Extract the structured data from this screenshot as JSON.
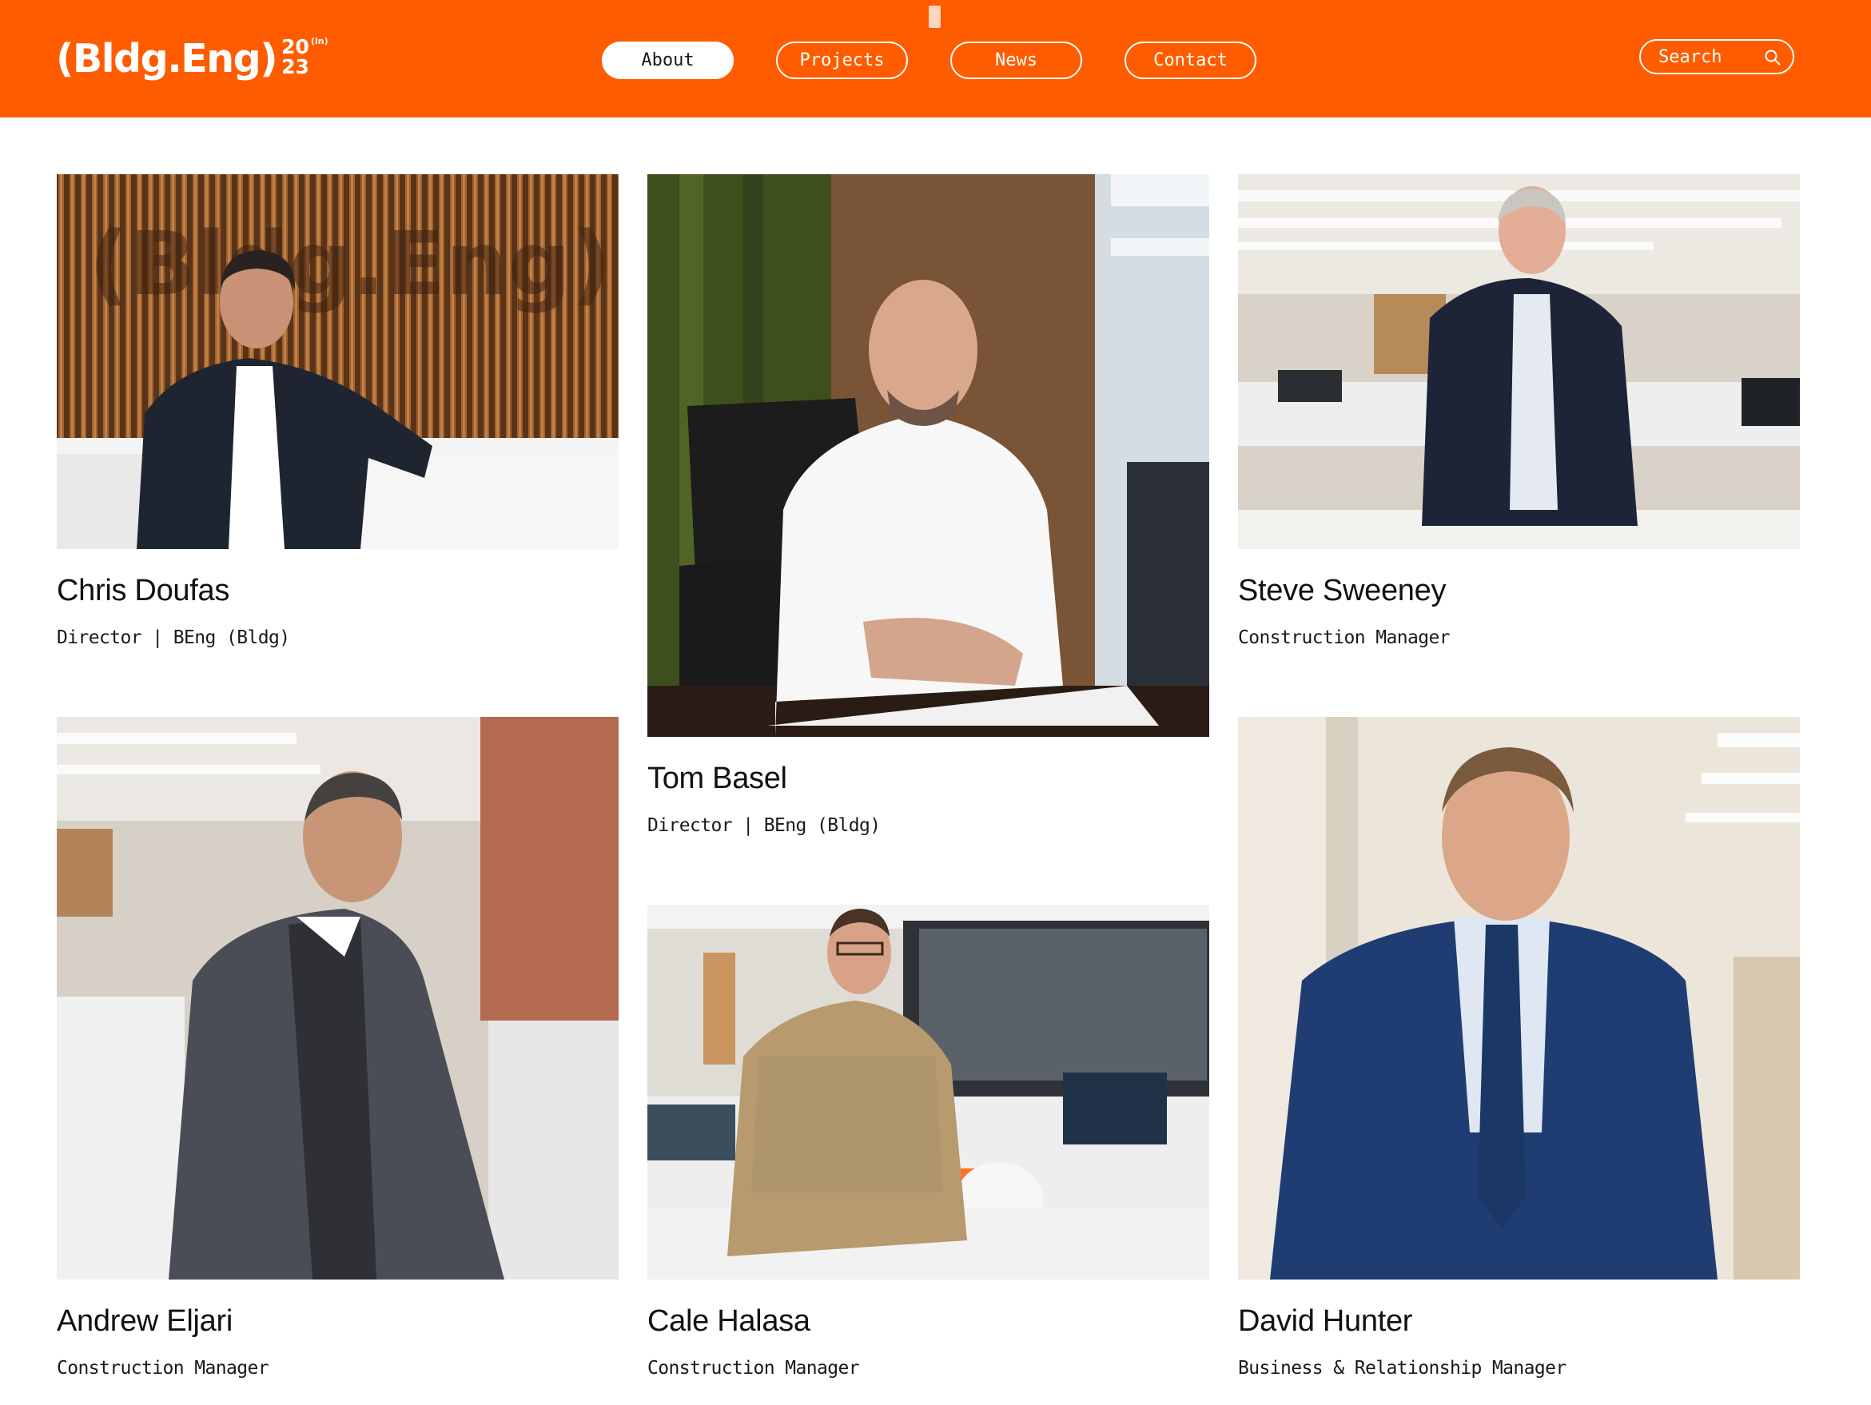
{
  "header": {
    "logo": {
      "word": "(Bldg.Eng)",
      "year_top": "20",
      "year_sup": "(in)",
      "year_bottom": "23"
    },
    "nav": [
      {
        "label": "About",
        "active": true
      },
      {
        "label": "Projects",
        "active": false
      },
      {
        "label": "News",
        "active": false
      },
      {
        "label": "Contact",
        "active": false
      }
    ],
    "search": {
      "placeholder": "Search",
      "icon": "search-icon"
    }
  },
  "colors": {
    "brand": "#ff5c00",
    "text": "#111111",
    "background": "#ffffff"
  },
  "team": [
    {
      "name": "Chris Doufas",
      "role": "Director | BEng (Bldg)"
    },
    {
      "name": "Tom Basel",
      "role": "Director | BEng (Bldg)"
    },
    {
      "name": "Steve Sweeney",
      "role": "Construction Manager"
    },
    {
      "name": "Andrew Eljari",
      "role": "Construction Manager"
    },
    {
      "name": "Cale Halasa",
      "role": "Construction Manager"
    },
    {
      "name": "David Hunter",
      "role": "Business & Relationship Manager"
    }
  ]
}
